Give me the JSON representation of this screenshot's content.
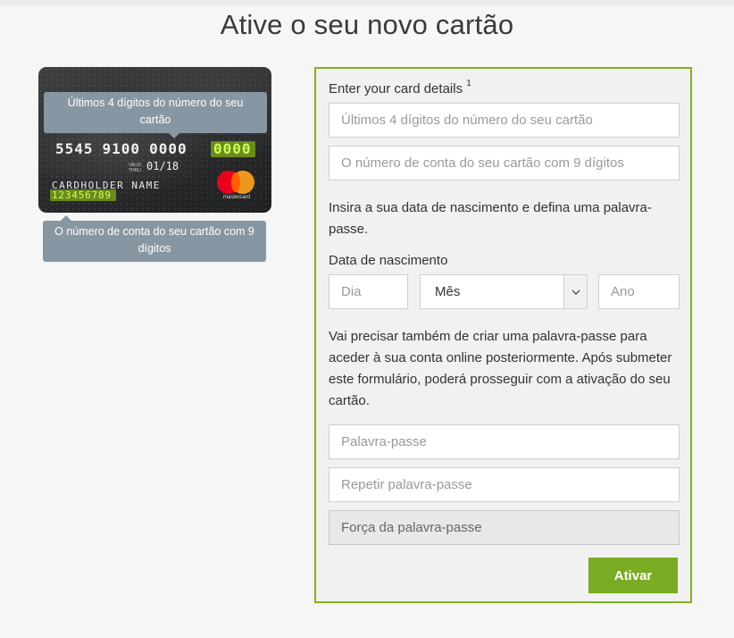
{
  "page": {
    "title": "Ative o seu novo cartão"
  },
  "card_illustration": {
    "number_groups": [
      "5545",
      "9100",
      "0000"
    ],
    "last4_placeholder": "0000",
    "valid_thru_label": "VALID THRU",
    "expiry": "01/18",
    "holder": "CARDHOLDER NAME",
    "account_number": "123456789",
    "brand": "mastercard",
    "tooltip_last4": "Últimos 4 dígitos do número do seu cartão",
    "tooltip_account": "O número de conta do seu cartão com 9 dígitos",
    "highlight_color": "#c9ff58"
  },
  "form": {
    "card_details_label": "Enter your card details",
    "card_details_sup": "1",
    "last4_placeholder": "Últimos 4 dígitos do número do seu cartão",
    "account_placeholder": "O número de conta do seu cartão com 9 dígitos",
    "dob_intro": "Insira a sua data de nascimento e defina uma palavra-passe.",
    "dob_label": "Data de nascimento",
    "day_placeholder": "Dia",
    "month_value": "Mês",
    "year_placeholder": "Ano",
    "password_intro": "Vai precisar também de criar uma palavra-passe para aceder à sua conta online posteriormente. Após submeter este formulário, poderá prosseguir com a ativação do seu cartão.",
    "password_placeholder": "Palavra-passe",
    "repeat_password_placeholder": "Repetir palavra-passe",
    "strength_placeholder": "Força da palavra-passe",
    "submit_label": "Ativar"
  },
  "colors": {
    "accent": "#79ac22",
    "border_green": "#7fb31f",
    "tooltip_bg": "#8796a3"
  }
}
